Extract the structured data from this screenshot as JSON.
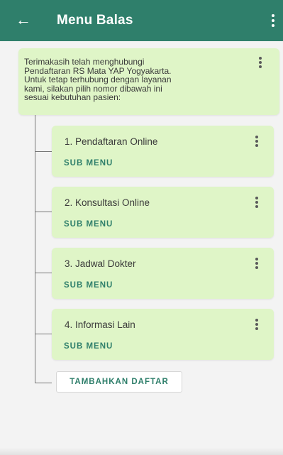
{
  "app_bar": {
    "title": "Menu Balas",
    "back_icon": "arrow-left-icon",
    "overflow_icon": "more-vert-icon",
    "color": "#2f7f6b"
  },
  "root_message": {
    "text": "Terimakasih telah menghubungi\nPendaftaran RS Mata YAP Yogyakarta.\nUntuk tetap terhubung dengan layanan\nkami, silakan pilih nomor dibawah ini\nsesuai kebutuhan pasien:",
    "card_color": "#dff5c7"
  },
  "menu_items": [
    {
      "label": "1. Pendaftaran Online",
      "sub_label": "SUB MENU"
    },
    {
      "label": "2. Konsultasi Online",
      "sub_label": "SUB MENU"
    },
    {
      "label": "3. Jadwal Dokter",
      "sub_label": "SUB MENU"
    },
    {
      "label": "4. Informasi Lain",
      "sub_label": "SUB MENU"
    }
  ],
  "add_button": {
    "label": "TAMBAHKAN DAFTAR"
  }
}
